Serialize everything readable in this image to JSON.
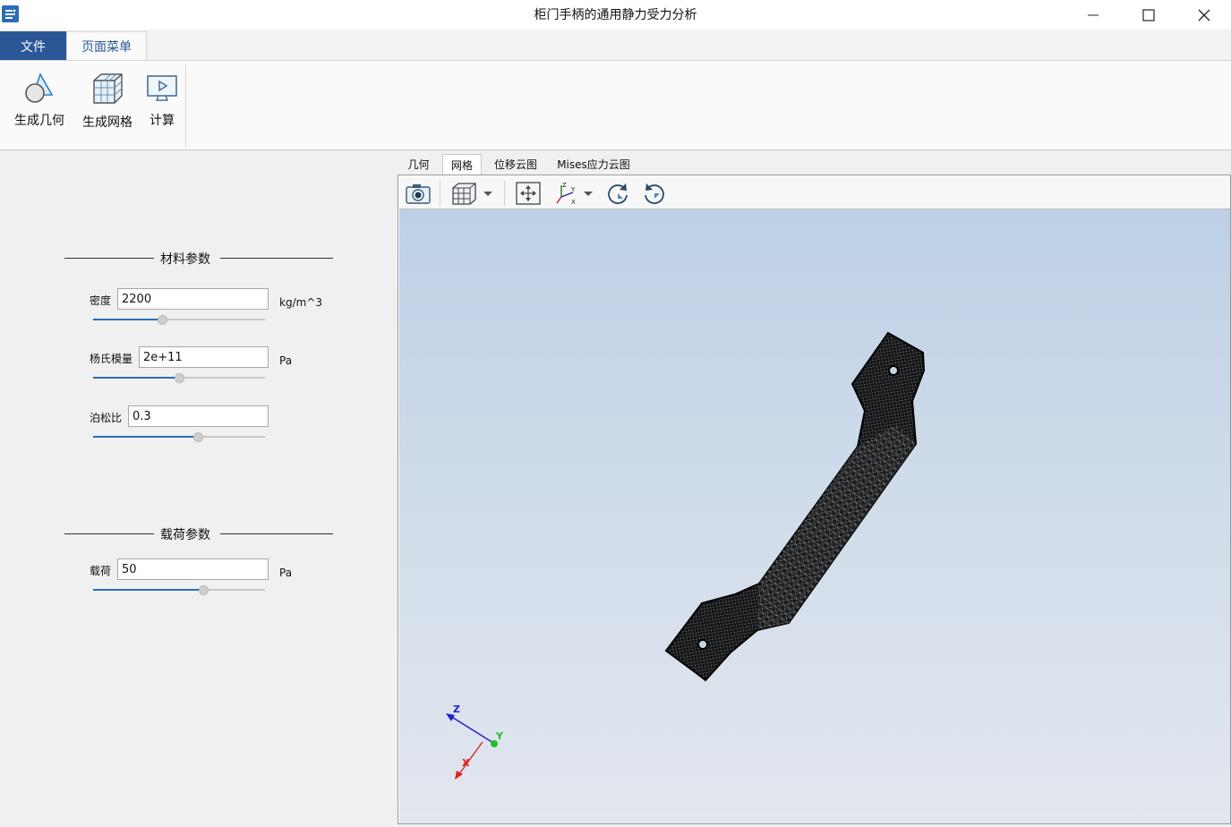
{
  "window": {
    "title": "柜门手柄的通用静力受力分析"
  },
  "ribbon": {
    "tabs": {
      "file": "文件",
      "page_menu": "页面菜单"
    },
    "buttons": {
      "gen_geometry": "生成几何",
      "gen_mesh": "生成网格",
      "compute": "计算"
    }
  },
  "material": {
    "title": "材料参数",
    "density": {
      "label": "密度",
      "value": "2200",
      "unit": "kg/m^3",
      "slider": 0.4
    },
    "youngs": {
      "label": "杨氏模量",
      "value": "2e+11",
      "unit": "Pa",
      "slider": 0.5
    },
    "poisson": {
      "label": "泊松比",
      "value": "0.3",
      "slider": 0.61
    }
  },
  "load": {
    "title": "载荷参数",
    "load": {
      "label": "载荷",
      "value": "50",
      "unit": "Pa",
      "slider": 0.64
    }
  },
  "view_tabs": [
    "几何",
    "网格",
    "位移云图",
    "Mises应力云图"
  ],
  "view_tabs_active": 1,
  "toolbar_icons": [
    "camera-icon",
    "cube-view-icon",
    "fit-view-icon",
    "axes-icon",
    "rotate-cw-icon",
    "rotate-ccw-icon"
  ],
  "axes": {
    "x": "X",
    "y": "Y",
    "z": "Z"
  },
  "colors": {
    "accent": "#2b5797",
    "slider": "#2b6cb8",
    "axis_x": "#e02020",
    "axis_y": "#20c020",
    "axis_z": "#2020d0"
  }
}
